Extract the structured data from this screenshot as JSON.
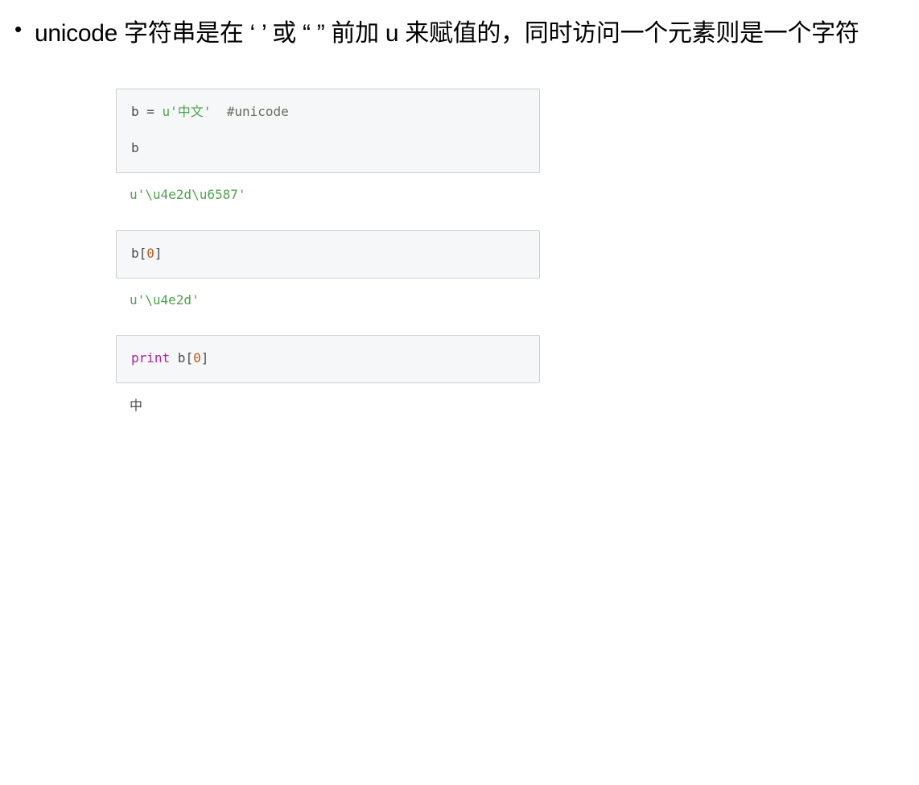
{
  "bullet": {
    "marker": "•",
    "text": "unicode 字符串是在 ‘ ’ 或 “ ” 前加 u 来赋值的，同时访问一个元素则是一个字符"
  },
  "cells": [
    {
      "input_lines": [
        [
          {
            "text": "b = ",
            "kind": "plain"
          },
          {
            "text": "u'中文'",
            "kind": "str"
          },
          {
            "text": "  #unicode",
            "kind": "comment"
          }
        ],
        [
          {
            "text": "b",
            "kind": "plain"
          }
        ]
      ],
      "output": {
        "text": "u'\\u4e2d\\u6587'",
        "kind": "str"
      }
    },
    {
      "input_lines": [
        [
          {
            "text": "b[",
            "kind": "plain"
          },
          {
            "text": "0",
            "kind": "num"
          },
          {
            "text": "]",
            "kind": "plain"
          }
        ]
      ],
      "output": {
        "text": "u'\\u4e2d'",
        "kind": "str"
      }
    },
    {
      "input_lines": [
        [
          {
            "text": "print",
            "kind": "kw"
          },
          {
            "text": " b[",
            "kind": "plain"
          },
          {
            "text": "0",
            "kind": "num"
          },
          {
            "text": "]",
            "kind": "plain"
          }
        ]
      ],
      "output": {
        "text": "中",
        "kind": "plain"
      }
    }
  ],
  "colors": {
    "string": "#50a14f",
    "comment": "#6b6b5f",
    "number": "#b75a1e",
    "keyword": "#a626a4",
    "code_background": "#f6f7f8",
    "code_border": "#cfcfcf"
  }
}
